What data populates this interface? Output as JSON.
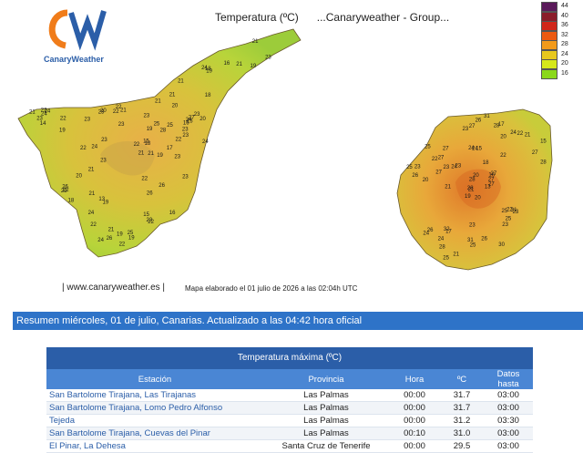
{
  "logo": {
    "text_top": "CW",
    "text_bottom": "CanaryWeather"
  },
  "map": {
    "title": "Temperatura (ºC)",
    "subtitle": "...Canaryweather - Group...",
    "legend": [
      {
        "value": "44",
        "color": "#5a1a5a"
      },
      {
        "value": "40",
        "color": "#8a1d2a"
      },
      {
        "value": "36",
        "color": "#d0261a"
      },
      {
        "value": "32",
        "color": "#ec5a12"
      },
      {
        "value": "28",
        "color": "#f29a1a"
      },
      {
        "value": "24",
        "color": "#e8c81e"
      },
      {
        "value": "20",
        "color": "#d6e81a"
      },
      {
        "value": "16",
        "color": "#8ad81a"
      }
    ],
    "footer_url": "| www.canaryweather.es |",
    "footer_note": "Mapa elaborado el 01 julio de 2026 a las 02:04h UTC",
    "tenerife_labels": [
      "19",
      "18",
      "16",
      "19",
      "18",
      "22",
      "19",
      "21",
      "18",
      "20",
      "18",
      "21",
      "22",
      "15",
      "14",
      "15",
      "15",
      "19",
      "16",
      "13",
      "22",
      "23",
      "24",
      "21",
      "23",
      "22",
      "23",
      "24",
      "16",
      "19",
      "23",
      "24",
      "21",
      "25",
      "26",
      "19",
      "23",
      "23",
      "25",
      "24",
      "26",
      "20",
      "28",
      "24",
      "24",
      "19",
      "22",
      "23",
      "20",
      "21",
      "21",
      "24",
      "23",
      "22",
      "21",
      "23",
      "22",
      "21",
      "21",
      "21",
      "19",
      "22",
      "20",
      "23",
      "26",
      "22",
      "23",
      "22",
      "17",
      "27",
      "25",
      "23",
      "22",
      "22",
      "21",
      "24",
      "21",
      "23",
      "22",
      "23",
      "26"
    ],
    "gc_labels": [
      "20",
      "21",
      "16",
      "17",
      "17",
      "15",
      "20",
      "13",
      "20",
      "15",
      "19",
      "22",
      "24",
      "18",
      "26",
      "23",
      "28",
      "24",
      "27",
      "23",
      "25",
      "27",
      "26",
      "25",
      "28",
      "28",
      "31",
      "28",
      "27",
      "24",
      "32",
      "31",
      "31",
      "24",
      "27",
      "23",
      "25",
      "25",
      "27",
      "25",
      "27",
      "24",
      "27",
      "25",
      "30",
      "24",
      "26",
      "21",
      "26",
      "21",
      "23",
      "27",
      "22",
      "28",
      "23",
      "20",
      "23",
      "21",
      "22",
      "23",
      "22"
    ]
  },
  "summary": {
    "text": "Resumen miércoles, 01 de julio, Canarias. Actualizado a las 04:42 hora oficial"
  },
  "table": {
    "title": "Temperatura máxima (ºC)",
    "headers": {
      "station": "Estación",
      "province": "Provincia",
      "hour": "Hora",
      "temp": "ºC",
      "data_until": "Datos hasta"
    },
    "rows": [
      {
        "station": "San Bartolome Tirajana, Las Tirajanas",
        "province": "Las Palmas",
        "hour": "00:00",
        "temp": "31.7",
        "data_until": "03:00"
      },
      {
        "station": "San Bartolome Tirajana, Lomo Pedro Alfonso",
        "province": "Las Palmas",
        "hour": "00:00",
        "temp": "31.7",
        "data_until": "03:00"
      },
      {
        "station": "Tejeda",
        "province": "Las Palmas",
        "hour": "00:00",
        "temp": "31.2",
        "data_until": "03:30"
      },
      {
        "station": "San Bartolome Tirajana, Cuevas del Pinar",
        "province": "Las Palmas",
        "hour": "00:10",
        "temp": "31.0",
        "data_until": "03:00"
      },
      {
        "station": "El Pinar, La Dehesa",
        "province": "Santa Cruz de Tenerife",
        "hour": "00:00",
        "temp": "29.5",
        "data_until": "03:00"
      }
    ]
  }
}
